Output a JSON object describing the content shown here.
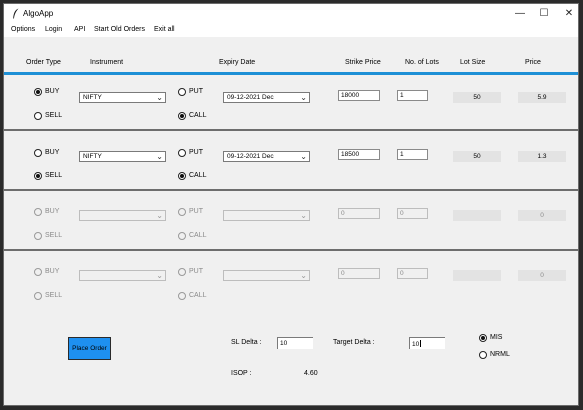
{
  "window": {
    "title": "AlgoApp",
    "min_glyph": "—",
    "max_glyph": "☐",
    "close_glyph": "✕"
  },
  "menu": [
    "Options",
    "Login",
    "API",
    "Start Old Orders",
    "Exit all"
  ],
  "headers": {
    "order_type": "Order Type",
    "instrument": "Instrument",
    "expiry_date": "Expiry Date",
    "strike_price": "Strike Price",
    "no_of_lots": "No. of Lots",
    "lot_size": "Lot Size",
    "price": "Price"
  },
  "labels": {
    "buy": "BUY",
    "sell": "SELL",
    "put": "PUT",
    "call": "CALL"
  },
  "rows": [
    {
      "enabled": true,
      "order_type": "BUY",
      "instrument": "NIFTY",
      "option": "CALL",
      "expiry": "09-12-2021 Dec",
      "strike": "18000",
      "lots": "1",
      "lot_size": "50",
      "price": "5.9"
    },
    {
      "enabled": true,
      "order_type": "SELL",
      "instrument": "NIFTY",
      "option": "CALL",
      "expiry": "09-12-2021 Dec",
      "strike": "18500",
      "lots": "1",
      "lot_size": "50",
      "price": "1.3"
    },
    {
      "enabled": false,
      "order_type": "",
      "instrument": "",
      "option": "",
      "expiry": "",
      "strike": "0",
      "lots": "0",
      "lot_size": "",
      "price": "0"
    },
    {
      "enabled": false,
      "order_type": "",
      "instrument": "",
      "option": "",
      "expiry": "",
      "strike": "0",
      "lots": "0",
      "lot_size": "",
      "price": "0"
    }
  ],
  "footer": {
    "place_order": "Place Order",
    "sl_delta_label": "SL Delta :",
    "sl_delta_value": "10",
    "target_delta_label": "Target Delta :",
    "target_delta_value": "10",
    "isop_label": "ISOP :",
    "isop_value": "4.60",
    "product_options": [
      "MIS",
      "NRML"
    ],
    "product_selected": "MIS"
  },
  "colors": {
    "accent_blue": "#1e90d6",
    "button_blue": "#1e90f0"
  }
}
